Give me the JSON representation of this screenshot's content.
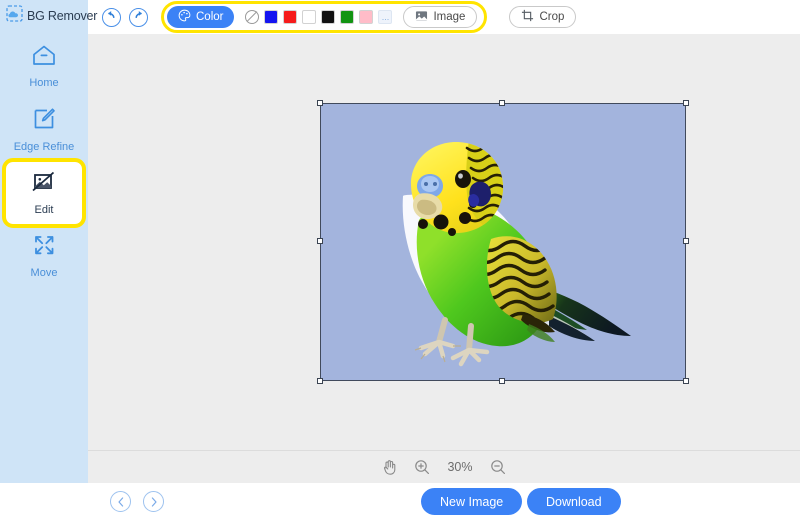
{
  "app": {
    "name": "BG Remover",
    "logo_icon": "dashed-selection-cloud-icon"
  },
  "sidebar": {
    "items": [
      {
        "label": "Home",
        "icon": "home-icon",
        "active": false
      },
      {
        "label": "Edge Refine",
        "icon": "edge-refine-pen-icon",
        "active": false
      },
      {
        "label": "Edit",
        "icon": "edit-image-icon",
        "active": true
      },
      {
        "label": "Move",
        "icon": "move-arrows-icon",
        "active": false
      }
    ]
  },
  "header": {
    "undo_icon": "undo-arrow-icon",
    "redo_icon": "redo-arrow-icon",
    "color_button": {
      "label": "Color",
      "icon": "palette-icon",
      "active": true
    },
    "image_button": {
      "label": "Image",
      "icon": "picture-icon"
    },
    "crop_button": {
      "label": "Crop",
      "icon": "crop-icon"
    },
    "swatches": [
      {
        "name": "transparent",
        "hex": "none"
      },
      {
        "name": "blue",
        "hex": "#1414f0"
      },
      {
        "name": "red",
        "hex": "#f61b1b"
      },
      {
        "name": "white",
        "hex": "#ffffff"
      },
      {
        "name": "black",
        "hex": "#111111"
      },
      {
        "name": "green",
        "hex": "#119411"
      },
      {
        "name": "pink",
        "hex": "#ffbcc8"
      },
      {
        "name": "more",
        "hex": "#eef3fb",
        "label": "..."
      }
    ]
  },
  "canvas": {
    "background_color": "#ededed",
    "artboard_background": "#a3b4dd",
    "subject": "green-yellow-budgerigar-parakeet",
    "selection_handles": 8
  },
  "zoombar": {
    "hand_icon": "hand-tool-icon",
    "zoom_in_icon": "zoom-in-icon",
    "zoom_out_icon": "zoom-out-icon",
    "zoom_level": "30%"
  },
  "footer": {
    "prev_icon": "chevron-left-icon",
    "next_icon": "chevron-right-icon",
    "new_image_label": "New Image",
    "download_label": "Download"
  },
  "colors": {
    "accent_blue": "#3b82f6",
    "sidebar_blue": "#cfe4f7",
    "highlight_yellow": "#ffe400",
    "canvas_gray": "#ededed"
  }
}
